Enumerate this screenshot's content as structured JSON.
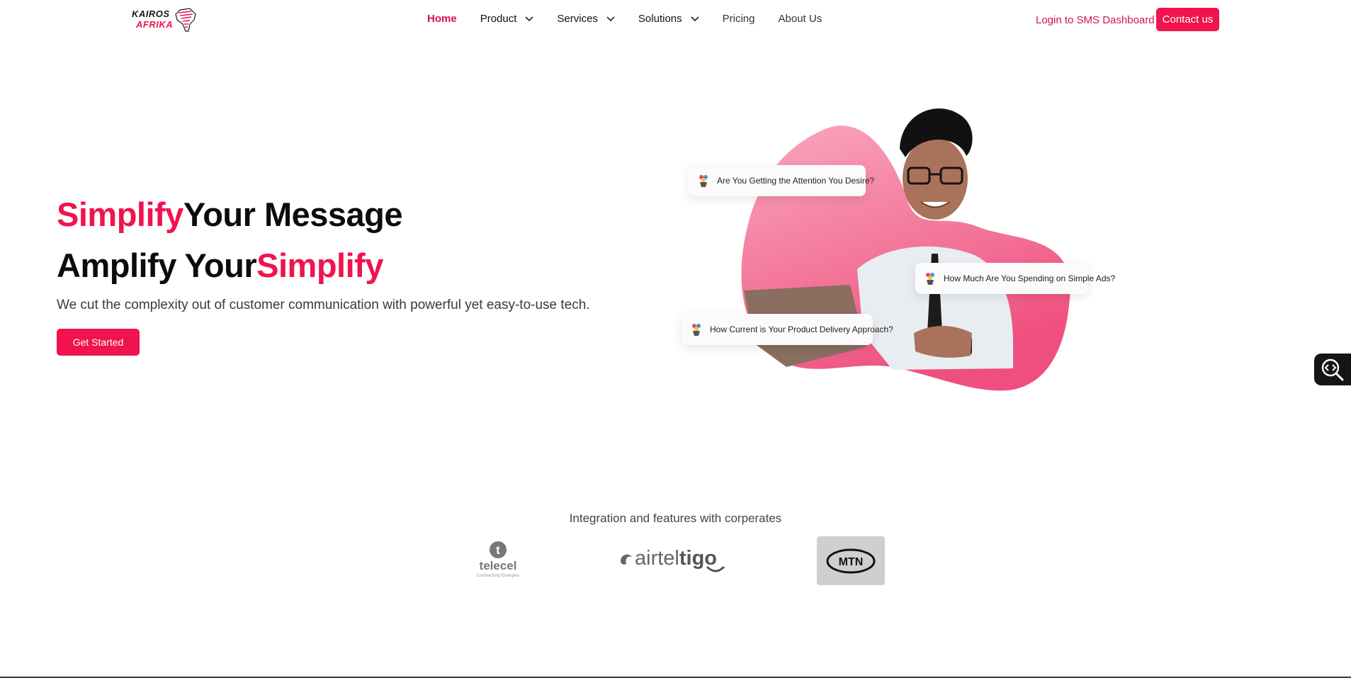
{
  "brand": {
    "logo_line1": "KAIROS",
    "logo_line2": "AFRIKA",
    "accent_color": "#f0134d"
  },
  "nav": {
    "items": [
      {
        "label": "Home",
        "has_dropdown": false,
        "active": true
      },
      {
        "label": "Product",
        "has_dropdown": true,
        "active": false
      },
      {
        "label": "Services",
        "has_dropdown": true,
        "active": false
      },
      {
        "label": "Solutions",
        "has_dropdown": true,
        "active": false
      },
      {
        "label": "Pricing",
        "has_dropdown": false,
        "active": false
      },
      {
        "label": "About Us",
        "has_dropdown": false,
        "active": false
      }
    ],
    "login_label": "Login to SMS Dashboard",
    "contact_label": "Contact us"
  },
  "hero": {
    "line1_accent": "Simplify",
    "line1_rest": "Your Message",
    "line2_rest": "Amplify Your",
    "line2_accent": "Simplify",
    "subtitle": "We cut the complexity out of customer communication with powerful yet easy-to-use tech.",
    "cta_label": "Get Started",
    "bubbles": [
      "Are You Getting the Attention You Desire?",
      "How Much Are You Spending on Simple Ads?",
      "How Current is Your Product Delivery Approach?"
    ],
    "image_icon": "person-with-laptop-illustration"
  },
  "partners": {
    "heading": "Integration and features with corperates",
    "logos": [
      {
        "name": "telecel",
        "mark": "t",
        "tagline": "Connecting Energies"
      },
      {
        "name": "airteltigo",
        "text_main": "airtel",
        "text_accent": "tigo"
      },
      {
        "name": "MTN",
        "text": "MTN"
      }
    ]
  },
  "widget": {
    "icon": "code-search-icon"
  }
}
